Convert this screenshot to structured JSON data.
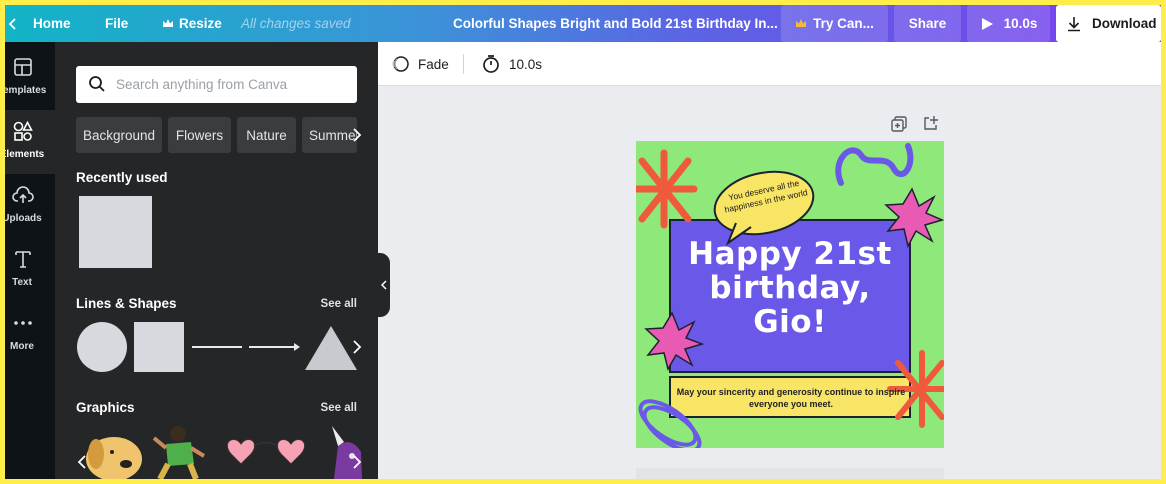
{
  "topbar": {
    "home_label": "Home",
    "file_label": "File",
    "resize_label": "Resize",
    "saved_status": "All changes saved",
    "document_title": "Colorful Shapes Bright and Bold 21st Birthday In...",
    "try_label": "Try Can...",
    "share_label": "Share",
    "play_duration": "10.0s",
    "download_label": "Download"
  },
  "rail": {
    "items": [
      {
        "label": "Templates",
        "icon": "template-icon"
      },
      {
        "label": "Elements",
        "icon": "shapes-icon"
      },
      {
        "label": "Uploads",
        "icon": "cloud-upload-icon"
      },
      {
        "label": "Text",
        "icon": "text-icon"
      },
      {
        "label": "More",
        "icon": "more-icon"
      }
    ]
  },
  "panel": {
    "search_placeholder": "Search anything from Canva",
    "chips": [
      "Background",
      "Flowers",
      "Nature",
      "Summer"
    ],
    "recently_used_title": "Recently used",
    "lines_shapes_title": "Lines & Shapes",
    "graphics_title": "Graphics",
    "see_all_label": "See all"
  },
  "subbar": {
    "fade_label": "Fade",
    "duration_label": "10.0s"
  },
  "design": {
    "bubble_text": "You deserve all the happiness in the world",
    "headline_line1": "Happy 21st",
    "headline_line2": "birthday,",
    "headline_line3": "Gio!",
    "footer_text": "May your sincerity and generosity continue to inspire everyone you meet.",
    "colors": {
      "background": "#8ee87a",
      "panel": "#6a58e8",
      "bubble": "#f9e565",
      "footer_band": "#f9e565",
      "starburst_red": "#ef5a3c",
      "starburst_pink": "#e85ab4",
      "outline": "#1c2230"
    }
  },
  "theme": {
    "accent": "#7b3ff0",
    "panel_bg": "#252627",
    "rail_bg": "#0e1318",
    "canvas_bg": "#ebecf0"
  }
}
